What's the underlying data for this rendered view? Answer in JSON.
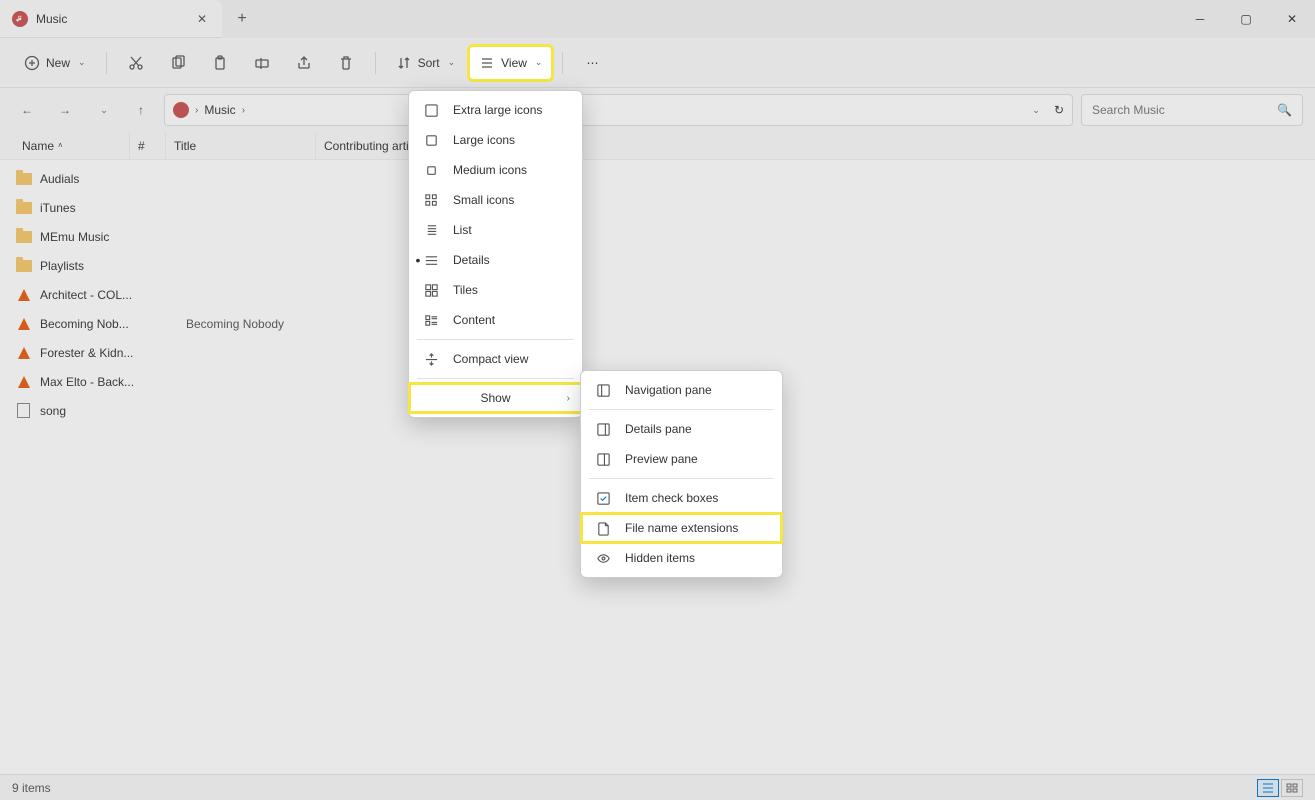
{
  "tab": {
    "title": "Music"
  },
  "toolbar": {
    "new": "New",
    "sort": "Sort",
    "view": "View"
  },
  "breadcrumb": {
    "item": "Music"
  },
  "search": {
    "placeholder": "Search Music"
  },
  "columns": {
    "name": "Name",
    "num": "#",
    "title": "Title",
    "artist": "Contributing artis"
  },
  "files": [
    {
      "name": "Audials",
      "type": "folder"
    },
    {
      "name": "iTunes",
      "type": "folder"
    },
    {
      "name": "MEmu Music",
      "type": "folder"
    },
    {
      "name": "Playlists",
      "type": "folder"
    },
    {
      "name": "Architect - COL...",
      "type": "vlc"
    },
    {
      "name": "Becoming Nob...",
      "type": "vlc",
      "title": "Becoming Nobody"
    },
    {
      "name": "Forester & Kidn...",
      "type": "vlc"
    },
    {
      "name": "Max Elto - Back...",
      "type": "vlc"
    },
    {
      "name": "song",
      "type": "file"
    }
  ],
  "viewMenu": {
    "extraLarge": "Extra large icons",
    "large": "Large icons",
    "medium": "Medium icons",
    "small": "Small icons",
    "list": "List",
    "details": "Details",
    "tiles": "Tiles",
    "content": "Content",
    "compact": "Compact view",
    "show": "Show"
  },
  "showMenu": {
    "navPane": "Navigation pane",
    "detailsPane": "Details pane",
    "previewPane": "Preview pane",
    "itemCheck": "Item check boxes",
    "fileExt": "File name extensions",
    "hidden": "Hidden items"
  },
  "status": {
    "count": "9 items"
  }
}
